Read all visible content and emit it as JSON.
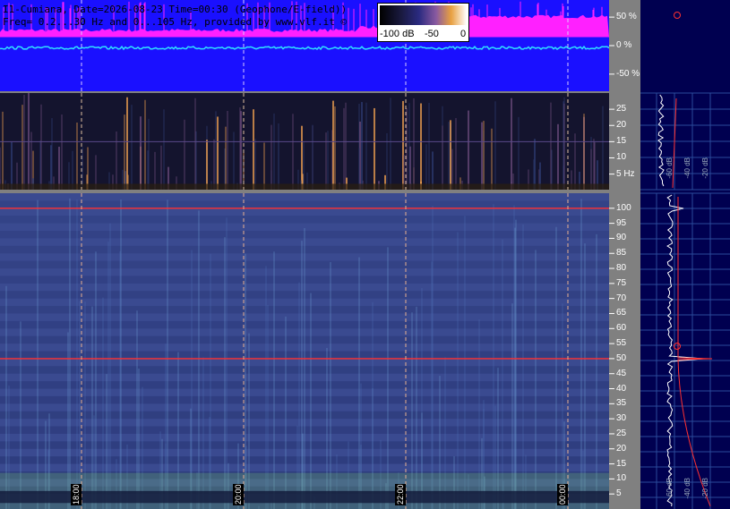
{
  "header": {
    "line1": "I1-Cumiana, Date=2026-08-23 Time=00:30 (Geophone/E-field))",
    "line2": "Freq= 0.2...30 Hz and 0...105 Hz, provided by www.vlf.it ©"
  },
  "colorbar": {
    "labels": [
      "-100 dB",
      "-50",
      "0"
    ]
  },
  "chart_data": [
    {
      "type": "line",
      "panel": "amplitude",
      "y_tick_labels": [
        "50 %",
        "0 %",
        "-50 %"
      ],
      "y_ticks": [
        50,
        0,
        -50
      ],
      "ylim": [
        -80,
        80
      ],
      "colors": {
        "background": "#1a10ff",
        "envelope": "#ff20ff",
        "signal": "#30e0ff"
      }
    },
    {
      "type": "heatmap",
      "panel": "spectrogram-0-30hz",
      "y_tick_labels": [
        "25",
        "20",
        "15",
        "10",
        "5 Hz"
      ],
      "y_ticks": [
        25,
        20,
        15,
        10,
        5
      ],
      "ylim": [
        0.2,
        30
      ],
      "colors": {
        "background": "#14142e",
        "stripes": "#f0a050"
      }
    },
    {
      "type": "heatmap",
      "panel": "spectrogram-0-105hz",
      "y_tick_labels": [
        "100",
        "95",
        "90",
        "85",
        "80",
        "75",
        "70",
        "65",
        "60",
        "55",
        "50",
        "45",
        "40",
        "35",
        "30",
        "25",
        "20",
        "15",
        "10",
        "5"
      ],
      "y_ticks": [
        100,
        95,
        90,
        85,
        80,
        75,
        70,
        65,
        60,
        55,
        50,
        45,
        40,
        35,
        30,
        25,
        20,
        15,
        10,
        5
      ],
      "ylim": [
        0,
        105
      ],
      "lines_hz": [
        100,
        50
      ],
      "time_labels": [
        "18:00",
        "20:00",
        "22:00",
        "00:00"
      ],
      "colors": {
        "background": "#3a4a90",
        "lines": "#ff3030",
        "low_band": "#7ad070"
      }
    },
    {
      "type": "line",
      "panel": "side-spectrum-top",
      "x_tick_labels": [
        "-60 dB",
        "-40 dB",
        "-20 dB"
      ],
      "x_ticks": [
        -60,
        -40,
        -20
      ]
    },
    {
      "type": "line",
      "panel": "side-spectrum-bottom",
      "x_tick_labels": [
        "-60 dB",
        "-40 dB",
        "-20 dB"
      ],
      "x_ticks": [
        -60,
        -40,
        -20
      ]
    }
  ]
}
